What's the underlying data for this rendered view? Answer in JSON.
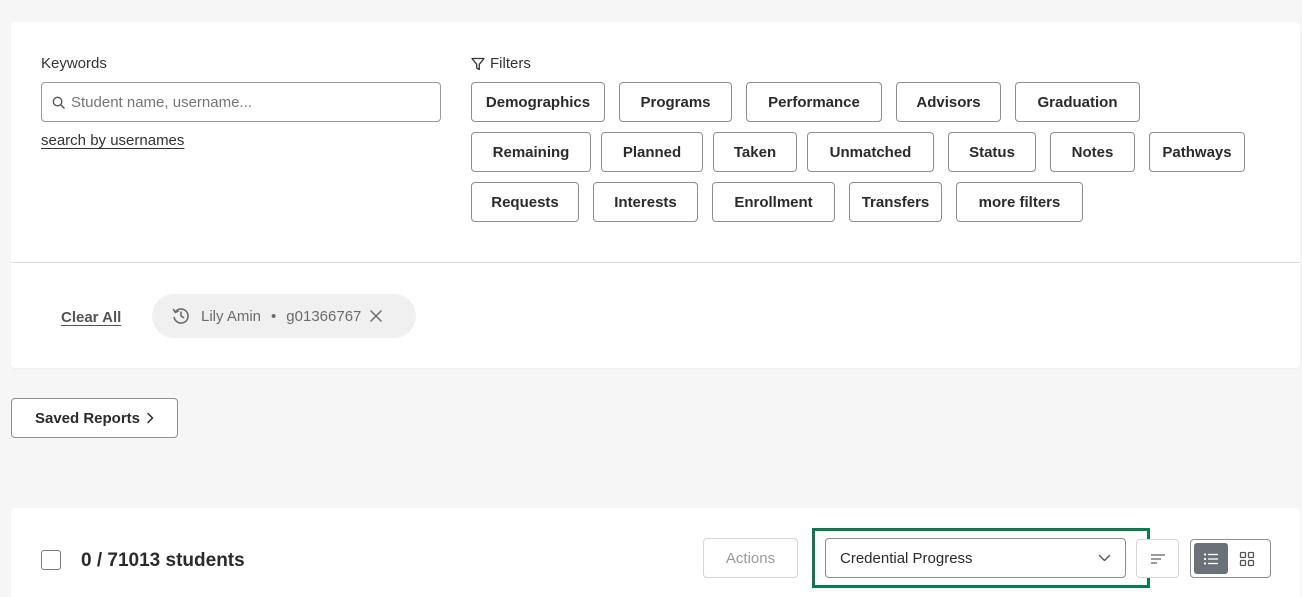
{
  "keywords": {
    "label": "Keywords",
    "placeholder": "Student name, username...",
    "search_by_usernames": "search by usernames"
  },
  "filters": {
    "label": "Filters",
    "chips": [
      "Demographics",
      "Programs",
      "Performance",
      "Advisors",
      "Graduation",
      "Remaining",
      "Planned",
      "Taken",
      "Unmatched",
      "Status",
      "Notes",
      "Pathways",
      "Requests",
      "Interests",
      "Enrollment",
      "Transfers",
      "more filters"
    ]
  },
  "applied": {
    "clear_all": "Clear All",
    "pill": {
      "name": "Lily Amin",
      "separator": "•",
      "id": "g01366767",
      "icon": "history-icon"
    }
  },
  "saved_reports": {
    "label": "Saved Reports",
    "icon": "chevron-right-icon"
  },
  "results": {
    "count": "0 / 71013 students",
    "actions_label": "Actions",
    "view_select": {
      "selected": "Credential Progress",
      "icon": "chevron-down-icon"
    },
    "sort_icon": "sort-icon",
    "view_modes": {
      "active": "list",
      "options": [
        "list-icon",
        "grid-icon"
      ]
    },
    "highlight_color": "#0b7a4e"
  }
}
